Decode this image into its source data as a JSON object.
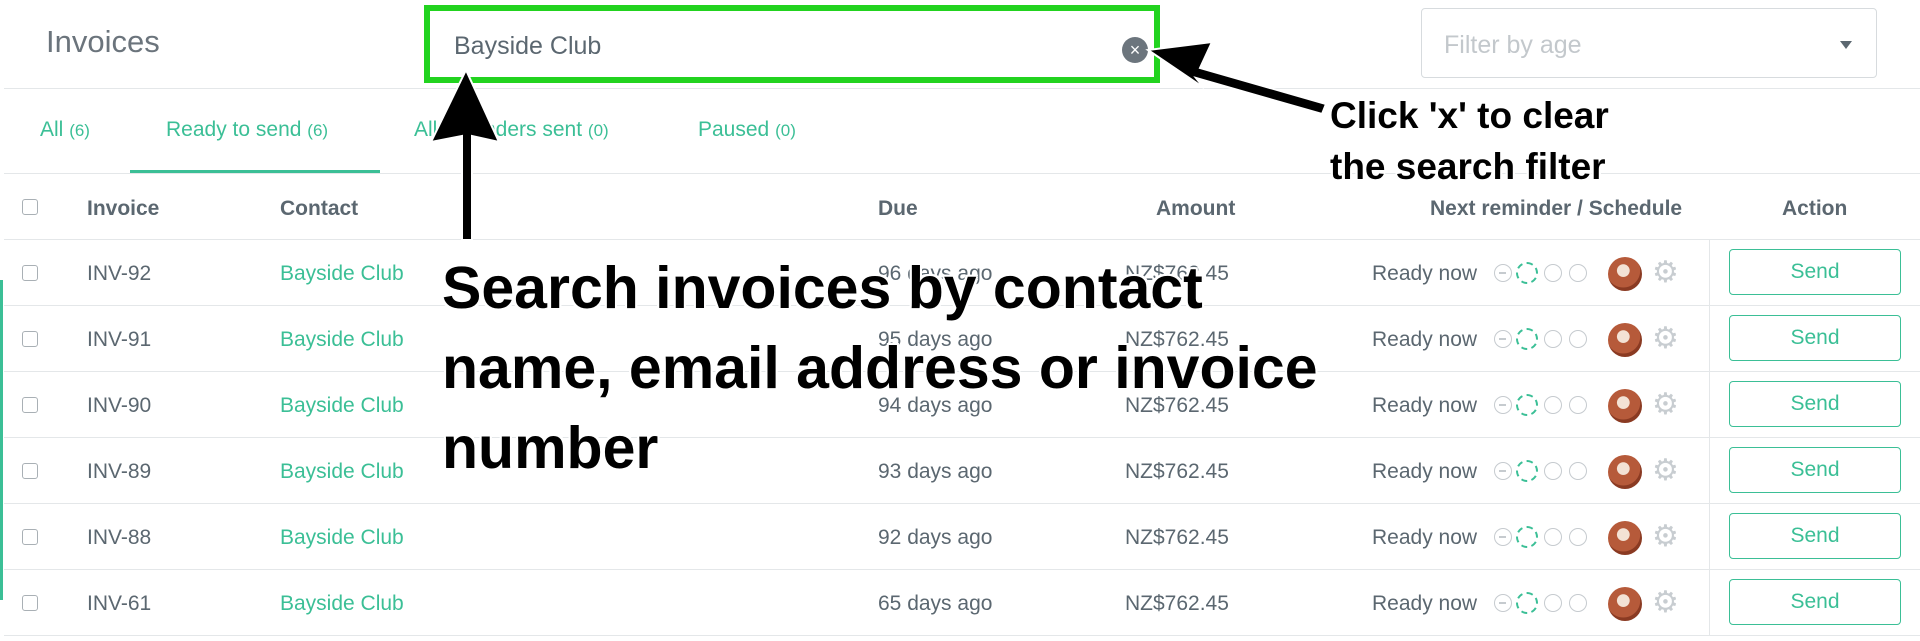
{
  "header": {
    "title": "Invoices",
    "search": {
      "value": "Bayside Club",
      "clear_glyph": "×"
    },
    "filter": {
      "placeholder": "Filter by age"
    }
  },
  "tabs": [
    {
      "label": "All",
      "count": "(6)"
    },
    {
      "label": "Ready to send",
      "count": "(6)",
      "active": true
    },
    {
      "label": "All reminders sent",
      "count": "(0)"
    },
    {
      "label": "Paused",
      "count": "(0)"
    }
  ],
  "table": {
    "columns": [
      "Invoice",
      "Contact",
      "Due",
      "Amount",
      "Next reminder / Schedule",
      "Action"
    ],
    "rows": [
      {
        "invoice": "INV-92",
        "contact": "Bayside Club",
        "due": "96 days ago",
        "amount": "NZ$762.45",
        "next": "Ready now",
        "action": "Send"
      },
      {
        "invoice": "INV-91",
        "contact": "Bayside Club",
        "due": "95 days ago",
        "amount": "NZ$762.45",
        "next": "Ready now",
        "action": "Send"
      },
      {
        "invoice": "INV-90",
        "contact": "Bayside Club",
        "due": "94 days ago",
        "amount": "NZ$762.45",
        "next": "Ready now",
        "action": "Send"
      },
      {
        "invoice": "INV-89",
        "contact": "Bayside Club",
        "due": "93 days ago",
        "amount": "NZ$762.45",
        "next": "Ready now",
        "action": "Send"
      },
      {
        "invoice": "INV-88",
        "contact": "Bayside Club",
        "due": "92 days ago",
        "amount": "NZ$762.45",
        "next": "Ready now",
        "action": "Send"
      },
      {
        "invoice": "INV-61",
        "contact": "Bayside Club",
        "due": "65 days ago",
        "amount": "NZ$762.45",
        "next": "Ready now",
        "action": "Send"
      }
    ]
  },
  "annotations": {
    "search_hint": "Search invoices by contact name, email address or invoice number",
    "clear_hint": "Click 'x' to clear the search filter"
  },
  "colors": {
    "accent": "#3bbf96",
    "highlight": "#22d31f",
    "text": "#5b6770"
  },
  "icons": {
    "clear": "close-circle-icon",
    "caret": "chevron-down-icon",
    "settings": "gear-icon"
  }
}
